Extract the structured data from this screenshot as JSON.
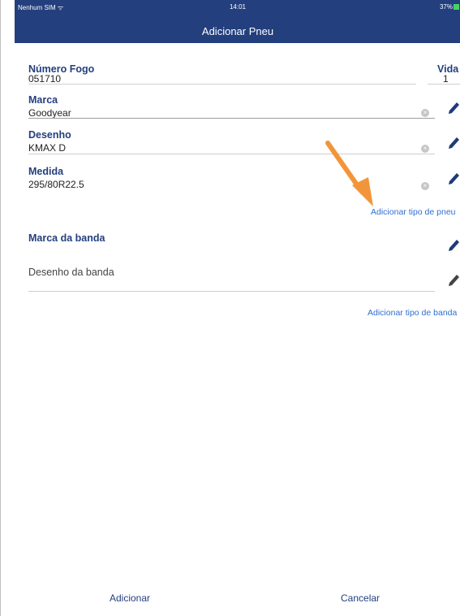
{
  "status_bar": {
    "carrier": "Nenhum SIM ᯤ",
    "time": "14:01",
    "battery": "37%"
  },
  "nav": {
    "title": "Adicionar Pneu"
  },
  "form": {
    "numero_fogo": {
      "label": "Número Fogo",
      "value": "051710"
    },
    "vida": {
      "label": "Vida",
      "value": "1"
    },
    "marca": {
      "label": "Marca",
      "value": "Goodyear"
    },
    "desenho": {
      "label": "Desenho",
      "value": "KMAX D"
    },
    "medida": {
      "label": "Medida",
      "value": "295/80R22.5"
    },
    "add_tire_type_link": "Adicionar tipo de pneu",
    "marca_banda": {
      "label": "Marca da banda"
    },
    "desenho_banda": {
      "label": "Desenho da banda"
    },
    "add_tread_type_link": "Adicionar tipo de banda"
  },
  "actions": {
    "add_label": "Adicionar",
    "cancel_label": "Cancelar"
  },
  "colors": {
    "header": "#233f7e",
    "label": "#233f7e",
    "link": "#2f6fd0",
    "annotation_arrow": "#f2953a"
  },
  "icons": {
    "clear": "clear-icon",
    "edit": "pencil-icon",
    "annotation": "arrow-annotation"
  }
}
